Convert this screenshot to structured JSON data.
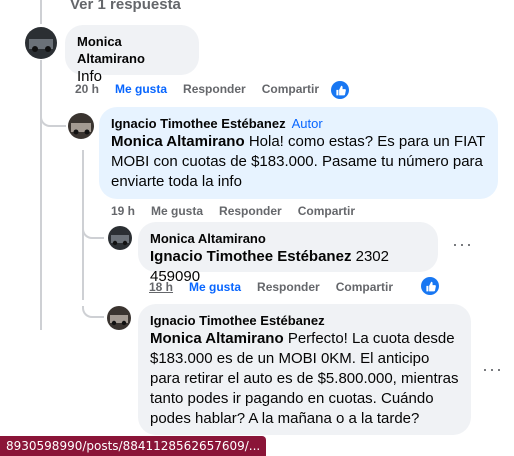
{
  "thread": {
    "view_replies": "Ver 1 respuesta"
  },
  "comments": [
    {
      "author": "Monica Altamirano",
      "text": "Info",
      "time": "20 h",
      "like": "Me gusta",
      "reply": "Responder",
      "share": "Compartir",
      "reaction_icon": "like-thumbs-up-icon"
    },
    {
      "author": "Ignacio Timothee Estébanez",
      "role": "Autor",
      "mention": "Monica Altamirano",
      "text": "Hola! como estas? Es para un FIAT MOBI con cuotas de $183.000. Pasame tu número para enviarte toda la info",
      "time": "19 h",
      "like": "Me gusta",
      "reply": "Responder",
      "share": "Compartir"
    },
    {
      "author": "Monica Altamirano",
      "mention": "Ignacio Timothee Estébanez",
      "text": "2302 459090",
      "time": "18 h",
      "like": "Me gusta",
      "reply": "Responder",
      "share": "Compartir",
      "reaction_icon": "like-thumbs-up-icon"
    },
    {
      "author": "Ignacio Timothee Estébanez",
      "mention": "Monica Altamirano",
      "text": "Perfecto! La cuota desde $183.000 es de un MOBI 0KM. El anticipo para retirar el auto es de $5.800.000, mientras tanto podes ir pagando en cuotas. Cuándo podes hablar? A la mañana o a la tarde?"
    }
  ],
  "status_bar": {
    "url": "8930598990/posts/8841128562657609/..."
  },
  "colors": {
    "link_blue": "#0866ff",
    "bubble_gray": "#f0f2f5",
    "bubble_blue": "#e7f3ff",
    "muted": "#65676b",
    "status_bar": "#8a1538"
  }
}
